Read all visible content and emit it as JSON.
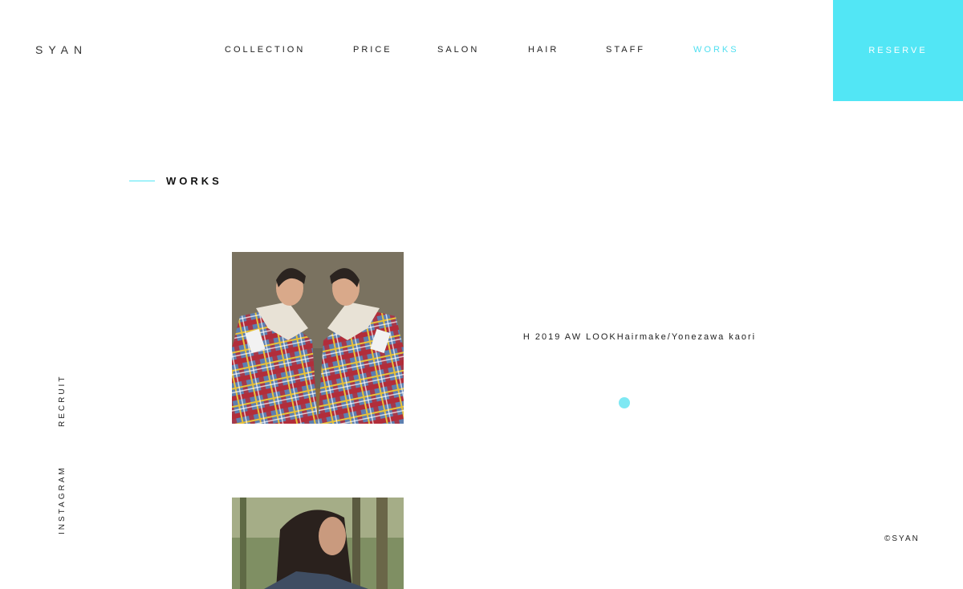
{
  "brand": {
    "logo": "SYAN",
    "accent_color": "#52e6f5"
  },
  "nav": {
    "items": [
      {
        "label": "COLLECTION"
      },
      {
        "label": "PRICE"
      },
      {
        "label": "SALON"
      },
      {
        "label": "HAIR"
      },
      {
        "label": "STAFF"
      },
      {
        "label": "WORKS",
        "active": true
      }
    ],
    "reserve_label": "RESERVE"
  },
  "section": {
    "title": "WORKS"
  },
  "side_links": {
    "recruit": "RECRUIT",
    "instagram": "INSTAGRAM"
  },
  "works": [
    {
      "caption": "H 2019 AW LOOKHairmake/Yonezawa kaori"
    },
    {
      "caption": ""
    }
  ],
  "footer": {
    "copyright": "©SYAN"
  }
}
